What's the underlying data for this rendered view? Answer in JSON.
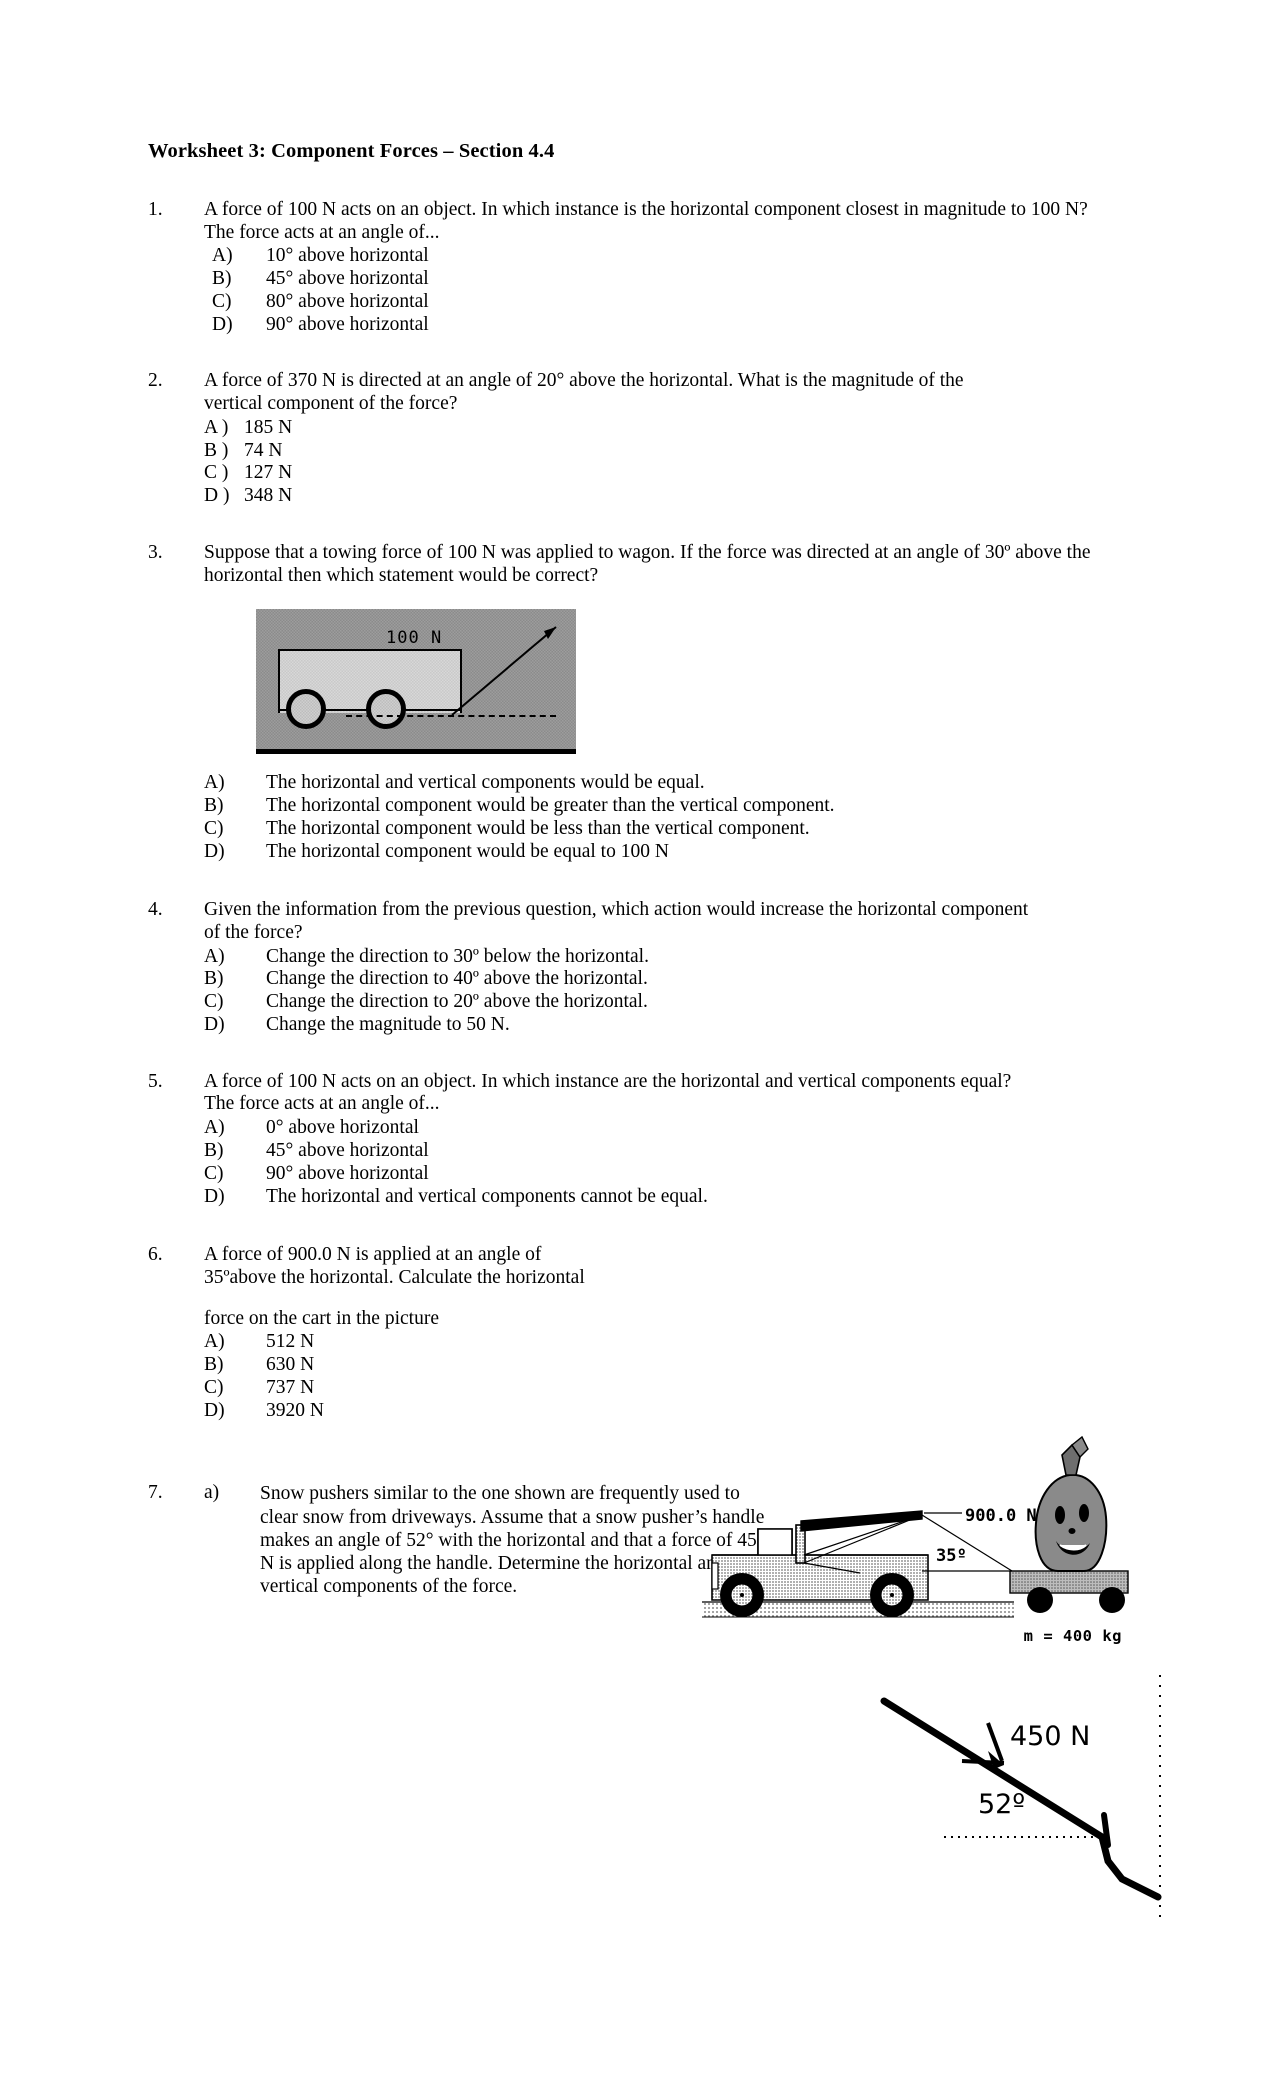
{
  "document": {
    "title": "Worksheet 3: Component Forces – Section 4.4"
  },
  "questions": [
    {
      "number": "1.",
      "text": "A force of 100 N acts on an object. In which instance is the horizontal component closest in magnitude to 100 N? The force acts at an angle of...",
      "options": [
        {
          "label": "A)",
          "value": "10° above horizontal"
        },
        {
          "label": "B)",
          "value": "45° above horizontal"
        },
        {
          "label": "C)",
          "value": "80° above horizontal"
        },
        {
          "label": "D)",
          "value": "90° above horizontal"
        }
      ]
    },
    {
      "number": "2.",
      "text": "A force of 370 N is directed at an angle of 20° above the horizontal. What is the magnitude of the vertical component of the force?",
      "options": [
        {
          "label": "A )",
          "value": "185 N"
        },
        {
          "label": "B )",
          "value": "74 N"
        },
        {
          "label": "C )",
          "value": "127 N"
        },
        {
          "label": "D )",
          "value": "348 N"
        }
      ]
    },
    {
      "number": "3.",
      "text": "Suppose that a towing force of 100 N was applied to wagon. If the force   was directed at an angle of 30º above the horizontal then which statement   would be correct?",
      "figure": {
        "force_label": "100 N"
      },
      "options": [
        {
          "label": "A)",
          "value": "The horizontal and vertical components would be equal."
        },
        {
          "label": "B)",
          "value": "The horizontal component would be greater than the vertical component."
        },
        {
          "label": "C)",
          "value": "The horizontal component would be less than the vertical component."
        },
        {
          "label": "D)",
          "value": "The horizontal component would be equal to 100 N"
        }
      ]
    },
    {
      "number": "4.",
      "text": "Given the information from the previous question, which action would increase the horizontal component of the force?",
      "options": [
        {
          "label": "A)",
          "value": "Change the direction to 30º below the horizontal."
        },
        {
          "label": "B)",
          "value": "Change the direction to 40º above the horizontal."
        },
        {
          "label": "C)",
          "value": "Change the direction to 20º above the horizontal."
        },
        {
          "label": "D)",
          "value": "Change the magnitude to 50 N."
        }
      ]
    },
    {
      "number": "5.",
      "text": "A force of 100 N acts on an object. In which instance are the horizontal and vertical components equal? The force acts at an angle of...",
      "options": [
        {
          "label": "A)",
          "value": "0° above horizontal"
        },
        {
          "label": "B)",
          "value": "45° above horizontal"
        },
        {
          "label": "C)",
          "value": "90° above horizontal"
        },
        {
          "label": "D)",
          "value": "The horizontal and vertical components cannot be equal."
        }
      ]
    },
    {
      "number": "6.",
      "text_line1": "A force of 900.0 N is applied at an angle of",
      "text_line2": "35ºabove the horizontal. Calculate the horizontal",
      "text_line3": "force on the cart in the picture",
      "figure": {
        "force_label": "900.0 N",
        "angle_label": "35º",
        "mass_label": "m = 400 kg"
      },
      "options": [
        {
          "label": "A)",
          "value": "512 N"
        },
        {
          "label": "B)",
          "value": "630 N"
        },
        {
          "label": "C)",
          "value": "737 N"
        },
        {
          "label": "D)",
          "value": "3920 N"
        }
      ]
    },
    {
      "number": "7.",
      "sub": "a)",
      "text": "Snow pushers similar to the one shown are frequently used to clear snow from driveways. Assume that a snow pusher’s handle makes an angle of 52° with the horizontal and that a force of 450 N is applied along the handle. Determine the horizontal and vertical components of the force.",
      "figure": {
        "force_label": "450 N",
        "angle_label": "52º"
      }
    }
  ]
}
